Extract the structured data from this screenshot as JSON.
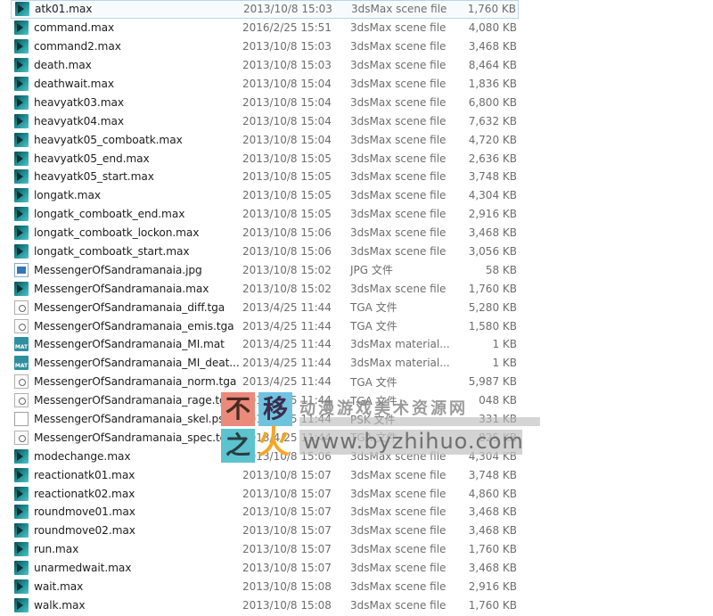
{
  "files": [
    {
      "name": "atk01.max",
      "date": "2013/10/8 15:03",
      "type": "3dsMax scene file",
      "size": "1,760 KB",
      "icon": "max-icon",
      "selected": true
    },
    {
      "name": "command.max",
      "date": "2016/2/25 15:51",
      "type": "3dsMax scene file",
      "size": "4,080 KB",
      "icon": "max-icon"
    },
    {
      "name": "command2.max",
      "date": "2013/10/8 15:03",
      "type": "3dsMax scene file",
      "size": "3,468 KB",
      "icon": "max-icon"
    },
    {
      "name": "death.max",
      "date": "2013/10/8 15:03",
      "type": "3dsMax scene file",
      "size": "8,464 KB",
      "icon": "max-icon"
    },
    {
      "name": "deathwait.max",
      "date": "2013/10/8 15:04",
      "type": "3dsMax scene file",
      "size": "1,836 KB",
      "icon": "max-icon"
    },
    {
      "name": "heavyatk03.max",
      "date": "2013/10/8 15:04",
      "type": "3dsMax scene file",
      "size": "6,800 KB",
      "icon": "max-icon"
    },
    {
      "name": "heavyatk04.max",
      "date": "2013/10/8 15:04",
      "type": "3dsMax scene file",
      "size": "7,632 KB",
      "icon": "max-icon"
    },
    {
      "name": "heavyatk05_comboatk.max",
      "date": "2013/10/8 15:04",
      "type": "3dsMax scene file",
      "size": "4,720 KB",
      "icon": "max-icon"
    },
    {
      "name": "heavyatk05_end.max",
      "date": "2013/10/8 15:05",
      "type": "3dsMax scene file",
      "size": "2,636 KB",
      "icon": "max-icon"
    },
    {
      "name": "heavyatk05_start.max",
      "date": "2013/10/8 15:05",
      "type": "3dsMax scene file",
      "size": "3,748 KB",
      "icon": "max-icon"
    },
    {
      "name": "longatk.max",
      "date": "2013/10/8 15:05",
      "type": "3dsMax scene file",
      "size": "4,304 KB",
      "icon": "max-icon"
    },
    {
      "name": "longatk_comboatk_end.max",
      "date": "2013/10/8 15:05",
      "type": "3dsMax scene file",
      "size": "2,916 KB",
      "icon": "max-icon"
    },
    {
      "name": "longatk_comboatk_lockon.max",
      "date": "2013/10/8 15:06",
      "type": "3dsMax scene file",
      "size": "3,468 KB",
      "icon": "max-icon"
    },
    {
      "name": "longatk_comboatk_start.max",
      "date": "2013/10/8 15:06",
      "type": "3dsMax scene file",
      "size": "3,056 KB",
      "icon": "max-icon"
    },
    {
      "name": "MessengerOfSandramanaia.jpg",
      "date": "2013/10/8 15:02",
      "type": "JPG 文件",
      "size": "58 KB",
      "icon": "jpg-icon"
    },
    {
      "name": "MessengerOfSandramanaia.max",
      "date": "2013/10/8 15:02",
      "type": "3dsMax scene file",
      "size": "1,760 KB",
      "icon": "max-icon"
    },
    {
      "name": "MessengerOfSandramanaia_diff.tga",
      "date": "2013/4/25 11:44",
      "type": "TGA 文件",
      "size": "5,280 KB",
      "icon": "tga-icon"
    },
    {
      "name": "MessengerOfSandramanaia_emis.tga",
      "date": "2013/4/25 11:44",
      "type": "TGA 文件",
      "size": "1,580 KB",
      "icon": "tga-icon"
    },
    {
      "name": "MessengerOfSandramanaia_MI.mat",
      "date": "2013/4/25 11:44",
      "type": "3dsMax material...",
      "size": "1 KB",
      "icon": "mat-icon"
    },
    {
      "name": "MessengerOfSandramanaia_MI_deat...",
      "date": "2013/4/25 11:44",
      "type": "3dsMax material...",
      "size": "1 KB",
      "icon": "mat-icon"
    },
    {
      "name": "MessengerOfSandramanaia_norm.tga",
      "date": "2013/4/25 11:44",
      "type": "TGA 文件",
      "size": "5,987 KB",
      "icon": "tga-icon"
    },
    {
      "name": "MessengerOfSandramanaia_rage.tga",
      "date": "2013/4/25 11:44",
      "type": "TGA 文件",
      "size": "048 KB",
      "icon": "tga-icon"
    },
    {
      "name": "MessengerOfSandramanaia_skel.psk",
      "date": "2013/4/25 11:44",
      "type": "PSK 文件",
      "size": "331 KB",
      "icon": "psk-icon"
    },
    {
      "name": "MessengerOfSandramanaia_spec.tga",
      "date": "2013/4/25 11:44",
      "type": "TGA 文件",
      "size": "825 KB",
      "icon": "tga-icon"
    },
    {
      "name": "modechange.max",
      "date": "2013/10/8 15:06",
      "type": "3dsMax scene file",
      "size": "4,304 KB",
      "icon": "max-icon"
    },
    {
      "name": "reactionatk01.max",
      "date": "2013/10/8 15:07",
      "type": "3dsMax scene file",
      "size": "3,748 KB",
      "icon": "max-icon"
    },
    {
      "name": "reactionatk02.max",
      "date": "2013/10/8 15:07",
      "type": "3dsMax scene file",
      "size": "4,860 KB",
      "icon": "max-icon"
    },
    {
      "name": "roundmove01.max",
      "date": "2013/10/8 15:07",
      "type": "3dsMax scene file",
      "size": "3,468 KB",
      "icon": "max-icon"
    },
    {
      "name": "roundmove02.max",
      "date": "2013/10/8 15:07",
      "type": "3dsMax scene file",
      "size": "3,468 KB",
      "icon": "max-icon"
    },
    {
      "name": "run.max",
      "date": "2013/10/8 15:07",
      "type": "3dsMax scene file",
      "size": "1,760 KB",
      "icon": "max-icon"
    },
    {
      "name": "unarmedwait.max",
      "date": "2013/10/8 15:07",
      "type": "3dsMax scene file",
      "size": "3,468 KB",
      "icon": "max-icon"
    },
    {
      "name": "wait.max",
      "date": "2013/10/8 15:08",
      "type": "3dsMax scene file",
      "size": "2,916 KB",
      "icon": "max-icon"
    },
    {
      "name": "walk.max",
      "date": "2013/10/8 15:08",
      "type": "3dsMax scene file",
      "size": "1,760 KB",
      "icon": "max-icon"
    }
  ],
  "watermark": {
    "logo_chars": [
      "不",
      "移",
      "之",
      "火"
    ],
    "tagline": "动漫游戏美术资源网",
    "url": "www.byzhihuo.com"
  }
}
